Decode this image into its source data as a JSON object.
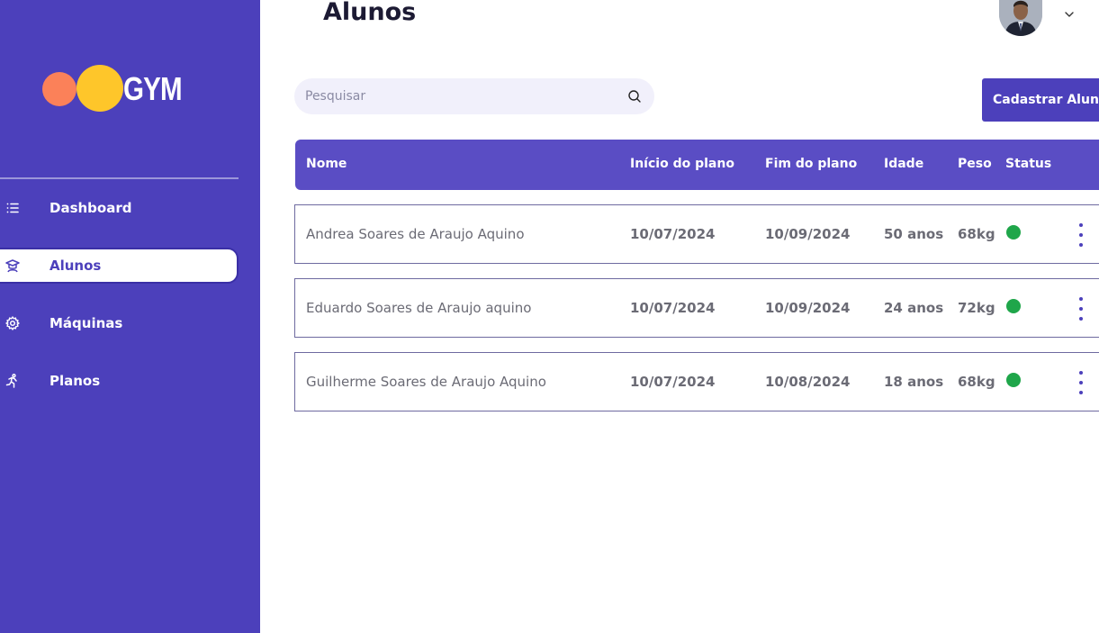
{
  "logo": {
    "text": "GYM"
  },
  "sidebar": {
    "items": [
      {
        "label": "Dashboard",
        "icon": "list-icon",
        "active": false
      },
      {
        "label": "Alunos",
        "icon": "student-icon",
        "active": true
      },
      {
        "label": "Máquinas",
        "icon": "gear-icon",
        "active": false
      },
      {
        "label": "Planos",
        "icon": "running-icon",
        "active": false
      }
    ]
  },
  "header": {
    "title": "Alunos"
  },
  "search": {
    "placeholder": "Pesquisar"
  },
  "actions": {
    "add_label": "Cadastrar Aluno"
  },
  "table": {
    "columns": [
      "Nome",
      "Início do plano",
      "Fim do plano",
      "Idade",
      "Peso",
      "Status"
    ],
    "rows": [
      {
        "nome": "Andrea Soares de Araujo Aquino",
        "inicio": "10/07/2024",
        "fim": "10/09/2024",
        "idade": "50 anos",
        "peso": "68kg",
        "status": "active"
      },
      {
        "nome": "Eduardo Soares de Araujo aquino",
        "inicio": "10/07/2024",
        "fim": "10/09/2024",
        "idade": "24 anos",
        "peso": "72kg",
        "status": "active"
      },
      {
        "nome": "Guilherme Soares de Araujo Aquino",
        "inicio": "10/07/2024",
        "fim": "10/08/2024",
        "idade": "18 anos",
        "peso": "68kg",
        "status": "active"
      }
    ]
  },
  "colors": {
    "sidebar": "#4c40bb",
    "table_header": "#5a4dc4",
    "status_active": "#1fa64a",
    "logo_orange": "#fb8159",
    "logo_yellow": "#fec62a"
  }
}
